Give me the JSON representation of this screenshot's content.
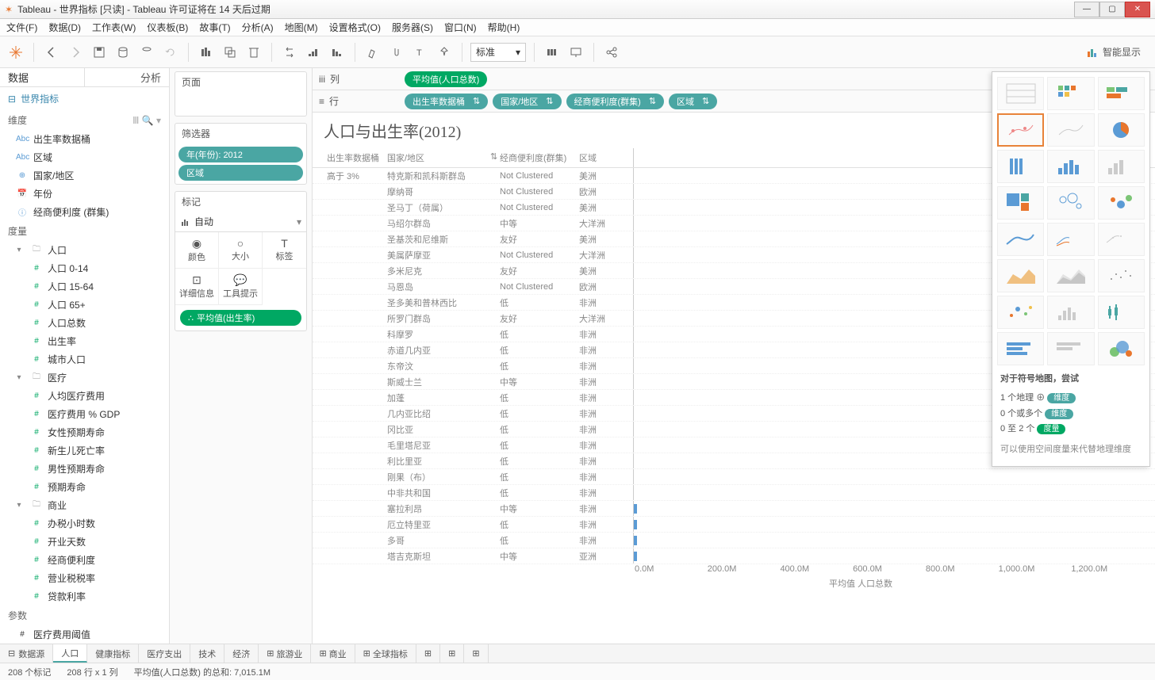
{
  "window": {
    "title": "Tableau - 世界指标 [只读] - Tableau 许可证将在 14 天后过期",
    "min": "—",
    "max": "▢",
    "close": "✕"
  },
  "menu": [
    "文件(F)",
    "数据(D)",
    "工作表(W)",
    "仪表板(B)",
    "故事(T)",
    "分析(A)",
    "地图(M)",
    "设置格式(O)",
    "服务器(S)",
    "窗口(N)",
    "帮助(H)"
  ],
  "toolbar": {
    "fit_mode": "标准",
    "showme_label": "智能显示"
  },
  "left": {
    "tabs": {
      "data": "数据",
      "analytics": "分析"
    },
    "datasource": "世界指标",
    "dims_header": "维度",
    "dims": [
      {
        "icon": "Abc",
        "label": "出生率数据桶"
      },
      {
        "icon": "Abc",
        "label": "区域"
      },
      {
        "icon": "⊕",
        "label": "国家/地区"
      },
      {
        "icon": "📅",
        "label": "年份"
      },
      {
        "icon": "ⓘ",
        "label": "经商便利度 (群集)"
      }
    ],
    "meas_header": "度量",
    "meas_groups": [
      {
        "folder": "人口",
        "items": [
          "人口 0-14",
          "人口 15-64",
          "人口 65+",
          "人口总数",
          "出生率",
          "城市人口"
        ]
      },
      {
        "folder": "医疗",
        "items": [
          "人均医疗费用",
          "医疗费用 % GDP",
          "女性预期寿命",
          "新生儿死亡率",
          "男性预期寿命",
          "预期寿命"
        ]
      },
      {
        "folder": "商业",
        "items": [
          "办税小时数",
          "开业天数",
          "经商便利度",
          "营业税税率",
          "贷款利率"
        ]
      }
    ],
    "params_header": "参数",
    "params": [
      "医疗费用阈值"
    ]
  },
  "shelves": {
    "pages": "页面",
    "filters": "筛选器",
    "filter_items": [
      "年(年份): 2012",
      "区域"
    ],
    "marks": "标记",
    "mark_type": "自动",
    "mark_cells": [
      "颜色",
      "大小",
      "标签",
      "详细信息",
      "工具提示"
    ],
    "mark_pill": "平均值(出生率)",
    "columns_label": "列",
    "rows_label": "行",
    "column_pill": "平均值(人口总数)",
    "row_pills": [
      "出生率数据桶",
      "国家/地区",
      "经商便利度(群集)",
      "区域"
    ]
  },
  "viz": {
    "title": "人口与出生率(2012)",
    "headers": {
      "bucket": "出生率数据桶",
      "country": "国家/地区",
      "cluster": "经商便利度(群集)",
      "region": "区域"
    },
    "bucket_label": "高于 3%",
    "rows": [
      {
        "country": "特克斯和凯科斯群岛",
        "cluster": "Not Clustered",
        "region": "美洲",
        "bar": 0
      },
      {
        "country": "摩纳哥",
        "cluster": "Not Clustered",
        "region": "欧洲",
        "bar": 0
      },
      {
        "country": "圣马丁（荷属）",
        "cluster": "Not Clustered",
        "region": "美洲",
        "bar": 0
      },
      {
        "country": "马绍尔群岛",
        "cluster": "中等",
        "region": "大洋洲",
        "bar": 0
      },
      {
        "country": "圣基茨和尼维斯",
        "cluster": "友好",
        "region": "美洲",
        "bar": 0
      },
      {
        "country": "美属萨摩亚",
        "cluster": "Not Clustered",
        "region": "大洋洲",
        "bar": 0
      },
      {
        "country": "多米尼克",
        "cluster": "友好",
        "region": "美洲",
        "bar": 0
      },
      {
        "country": "马恩岛",
        "cluster": "Not Clustered",
        "region": "欧洲",
        "bar": 0
      },
      {
        "country": "圣多美和普林西比",
        "cluster": "低",
        "region": "非洲",
        "bar": 0
      },
      {
        "country": "所罗门群岛",
        "cluster": "友好",
        "region": "大洋洲",
        "bar": 0
      },
      {
        "country": "科摩罗",
        "cluster": "低",
        "region": "非洲",
        "bar": 0
      },
      {
        "country": "赤道几内亚",
        "cluster": "低",
        "region": "非洲",
        "bar": 0
      },
      {
        "country": "东帝汶",
        "cluster": "低",
        "region": "非洲",
        "bar": 0
      },
      {
        "country": "斯威士兰",
        "cluster": "中等",
        "region": "非洲",
        "bar": 0
      },
      {
        "country": "加蓬",
        "cluster": "低",
        "region": "非洲",
        "bar": 0
      },
      {
        "country": "几内亚比绍",
        "cluster": "低",
        "region": "非洲",
        "bar": 0
      },
      {
        "country": "冈比亚",
        "cluster": "低",
        "region": "非洲",
        "bar": 0
      },
      {
        "country": "毛里塔尼亚",
        "cluster": "低",
        "region": "非洲",
        "bar": 0
      },
      {
        "country": "利比里亚",
        "cluster": "低",
        "region": "非洲",
        "bar": 0
      },
      {
        "country": "刚果（布）",
        "cluster": "低",
        "region": "非洲",
        "bar": 0
      },
      {
        "country": "中非共和国",
        "cluster": "低",
        "region": "非洲",
        "bar": 0
      },
      {
        "country": "塞拉利昂",
        "cluster": "中等",
        "region": "非洲",
        "bar": 1
      },
      {
        "country": "厄立特里亚",
        "cluster": "低",
        "region": "非洲",
        "bar": 1
      },
      {
        "country": "多哥",
        "cluster": "低",
        "region": "非洲",
        "bar": 1
      },
      {
        "country": "塔吉克斯坦",
        "cluster": "中等",
        "region": "亚洲",
        "bar": 1
      }
    ],
    "xaxis": [
      "0.0M",
      "200.0M",
      "400.0M",
      "600.0M",
      "800.0M",
      "1,000.0M",
      "1,200.0M"
    ],
    "xlabel": "平均值 人口总数"
  },
  "showme": {
    "hint_title": "对于符号地图，尝试",
    "hints": [
      {
        "pre": "1 个地理 ⊕",
        "tag": "维度",
        "cls": "tag"
      },
      {
        "pre": "0 个或多个",
        "tag": "维度",
        "cls": "tag"
      },
      {
        "pre": "0 至 2 个",
        "tag": "度量",
        "cls": "tag green"
      }
    ],
    "note": "可以使用空间度量来代替地理维度"
  },
  "sheets": {
    "datasource": "数据源",
    "items": [
      "人口",
      "健康指标",
      "医疗支出",
      "技术",
      "经济",
      "旅游业",
      "商业",
      "全球指标"
    ]
  },
  "status": {
    "marks": "208 个标记",
    "rowscols": "208 行 x 1 列",
    "agg": "平均值(人口总数) 的总和: 7,015.1M"
  }
}
